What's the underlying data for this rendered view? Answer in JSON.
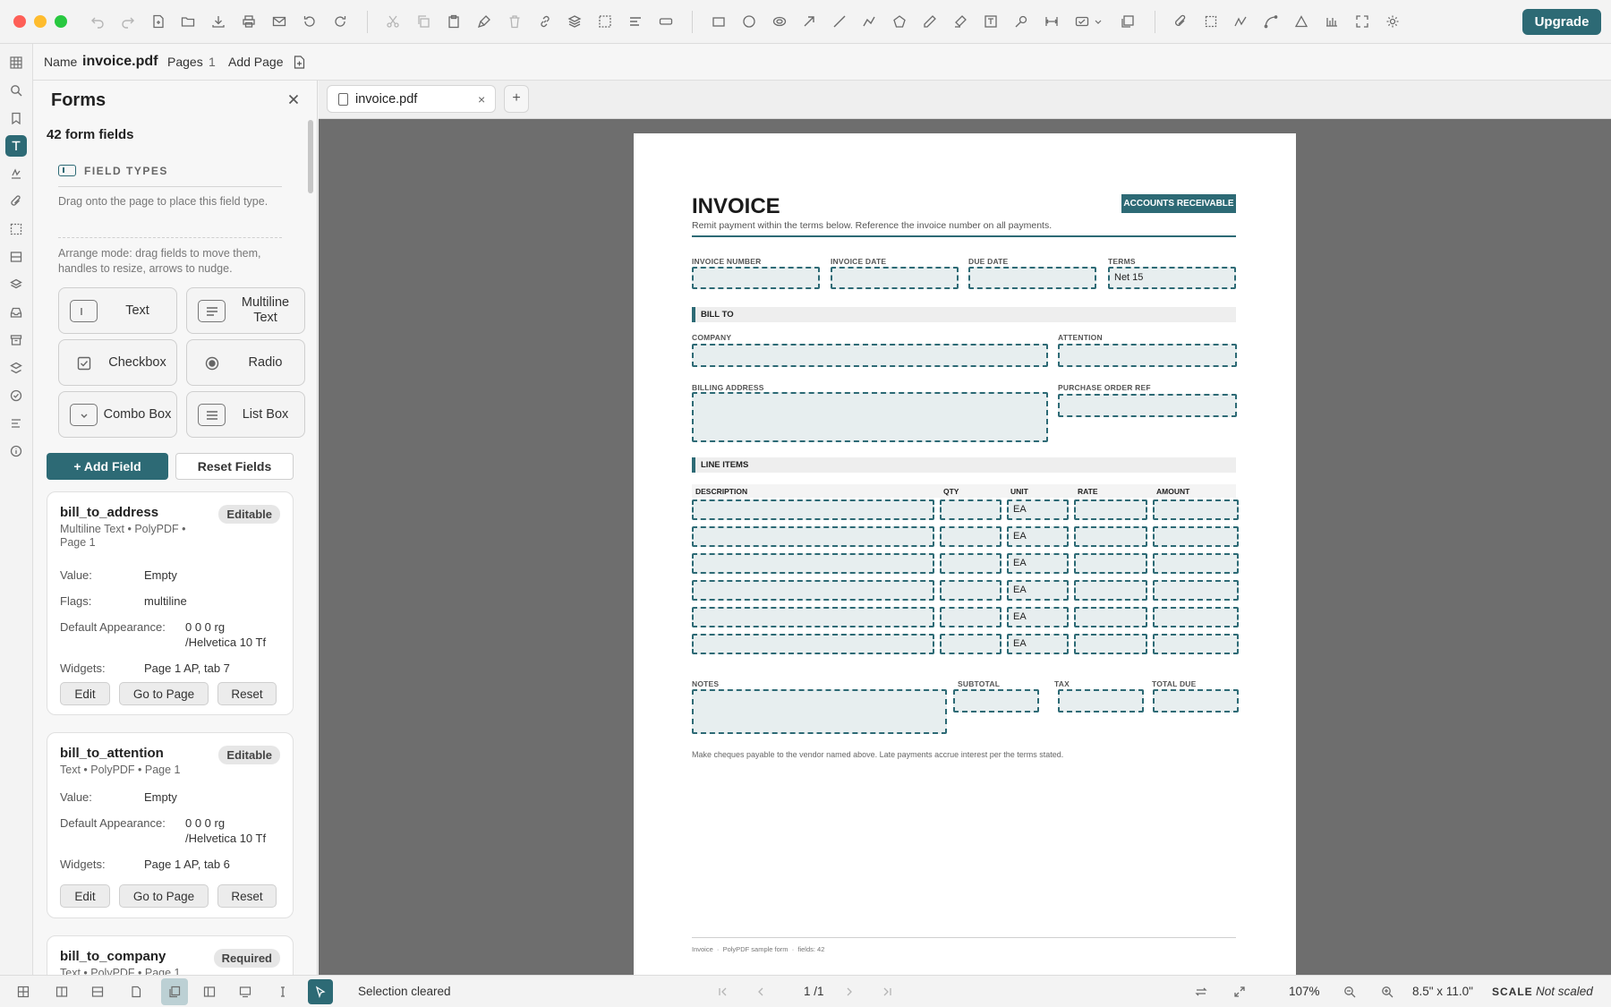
{
  "window": {
    "light_red": "#fe5f57",
    "light_yellow": "#febc2e",
    "light_green": "#28c840"
  },
  "toolbar": {
    "upgrade_label": "Upgrade"
  },
  "info_bar": {
    "name_label": "Name",
    "file_name": "invoice.pdf",
    "pages_label": "Pages",
    "pages_count": "1",
    "add_page_label": "Add Page"
  },
  "panel": {
    "title": "Forms",
    "field_count": "42 form fields",
    "field_types_heading": "FIELD TYPES",
    "drag_hint": "Drag onto the page to place this field type.",
    "arrange_hint": "Arrange mode: drag fields to move them, handles to resize, arrows to nudge.",
    "field_types": [
      {
        "label": "Text",
        "icon": "text-field-icon"
      },
      {
        "label": "Multiline Text",
        "icon": "multiline-text-icon"
      },
      {
        "label": "Checkbox",
        "icon": "checkbox-icon"
      },
      {
        "label": "Radio",
        "icon": "radio-icon"
      },
      {
        "label": "Combo Box",
        "icon": "combo-box-icon"
      },
      {
        "label": "List Box",
        "icon": "list-box-icon"
      }
    ],
    "add_field_label": "+ Add Field",
    "reset_fields_label": "Reset Fields",
    "cards": [
      {
        "name": "bill_to_address",
        "badge": "Editable",
        "subtitle": "Multiline Text • PolyPDF • Page 1",
        "value_label": "Value:",
        "value": "Empty",
        "flags_label": "Flags:",
        "flags": "multiline",
        "da_label": "Default Appearance:",
        "da": "0 0 0 rg /Helvetica 10 Tf",
        "widgets_label": "Widgets:",
        "widgets": "Page 1 AP, tab 7",
        "edit_label": "Edit",
        "goto_label": "Go to Page",
        "reset_label": "Reset"
      },
      {
        "name": "bill_to_attention",
        "badge": "Editable",
        "subtitle": "Text • PolyPDF • Page 1",
        "value_label": "Value:",
        "value": "Empty",
        "da_label": "Default Appearance:",
        "da": "0 0 0 rg /Helvetica 10 Tf",
        "widgets_label": "Widgets:",
        "widgets": "Page 1 AP, tab 6",
        "edit_label": "Edit",
        "goto_label": "Go to Page",
        "reset_label": "Reset"
      },
      {
        "name": "bill_to_company",
        "badge": "Required",
        "subtitle": "Text • PolyPDF • Page 1"
      }
    ]
  },
  "tabs": {
    "active_tab": "invoice.pdf",
    "close_glyph": "×",
    "add_glyph": "+"
  },
  "document": {
    "title": "INVOICE",
    "subtitle": "Remit payment within the terms below. Reference the invoice number on all payments.",
    "badge": "ACCOUNTS RECEIVABLE",
    "labels": {
      "invoice_number": "INVOICE NUMBER",
      "invoice_date": "INVOICE DATE",
      "due_date": "DUE DATE",
      "terms": "TERMS",
      "company": "COMPANY",
      "attention": "ATTENTION",
      "billing_address": "BILLING ADDRESS",
      "purchase_order_ref": "PURCHASE ORDER REF",
      "notes": "NOTES",
      "subtotal": "SUBTOTAL",
      "tax": "TAX",
      "total_due": "TOTAL DUE"
    },
    "values": {
      "terms": "Net 15"
    },
    "bill_to_heading": "BILL TO",
    "line_items_heading": "LINE ITEMS",
    "line_item_columns": [
      "DESCRIPTION",
      "QTY",
      "UNIT",
      "RATE",
      "AMOUNT"
    ],
    "line_item_rows": [
      {
        "unit": "EA"
      },
      {
        "unit": "EA"
      },
      {
        "unit": "EA"
      },
      {
        "unit": "EA"
      },
      {
        "unit": "EA"
      },
      {
        "unit": "EA"
      }
    ],
    "note": "Make cheques payable to the vendor named above. Late payments accrue interest per the terms stated.",
    "footer": "Invoice  ·  PolyPDF sample form  ·  fields: 42"
  },
  "status_bar": {
    "message": "Selection cleared",
    "page_indicator": "1 /1",
    "zoom": "107%",
    "page_size": "8.5\" x 11.0\"",
    "scale_label": "SCALE",
    "scale_value": "Not scaled"
  },
  "colors": {
    "accent": "#2d6a75"
  }
}
